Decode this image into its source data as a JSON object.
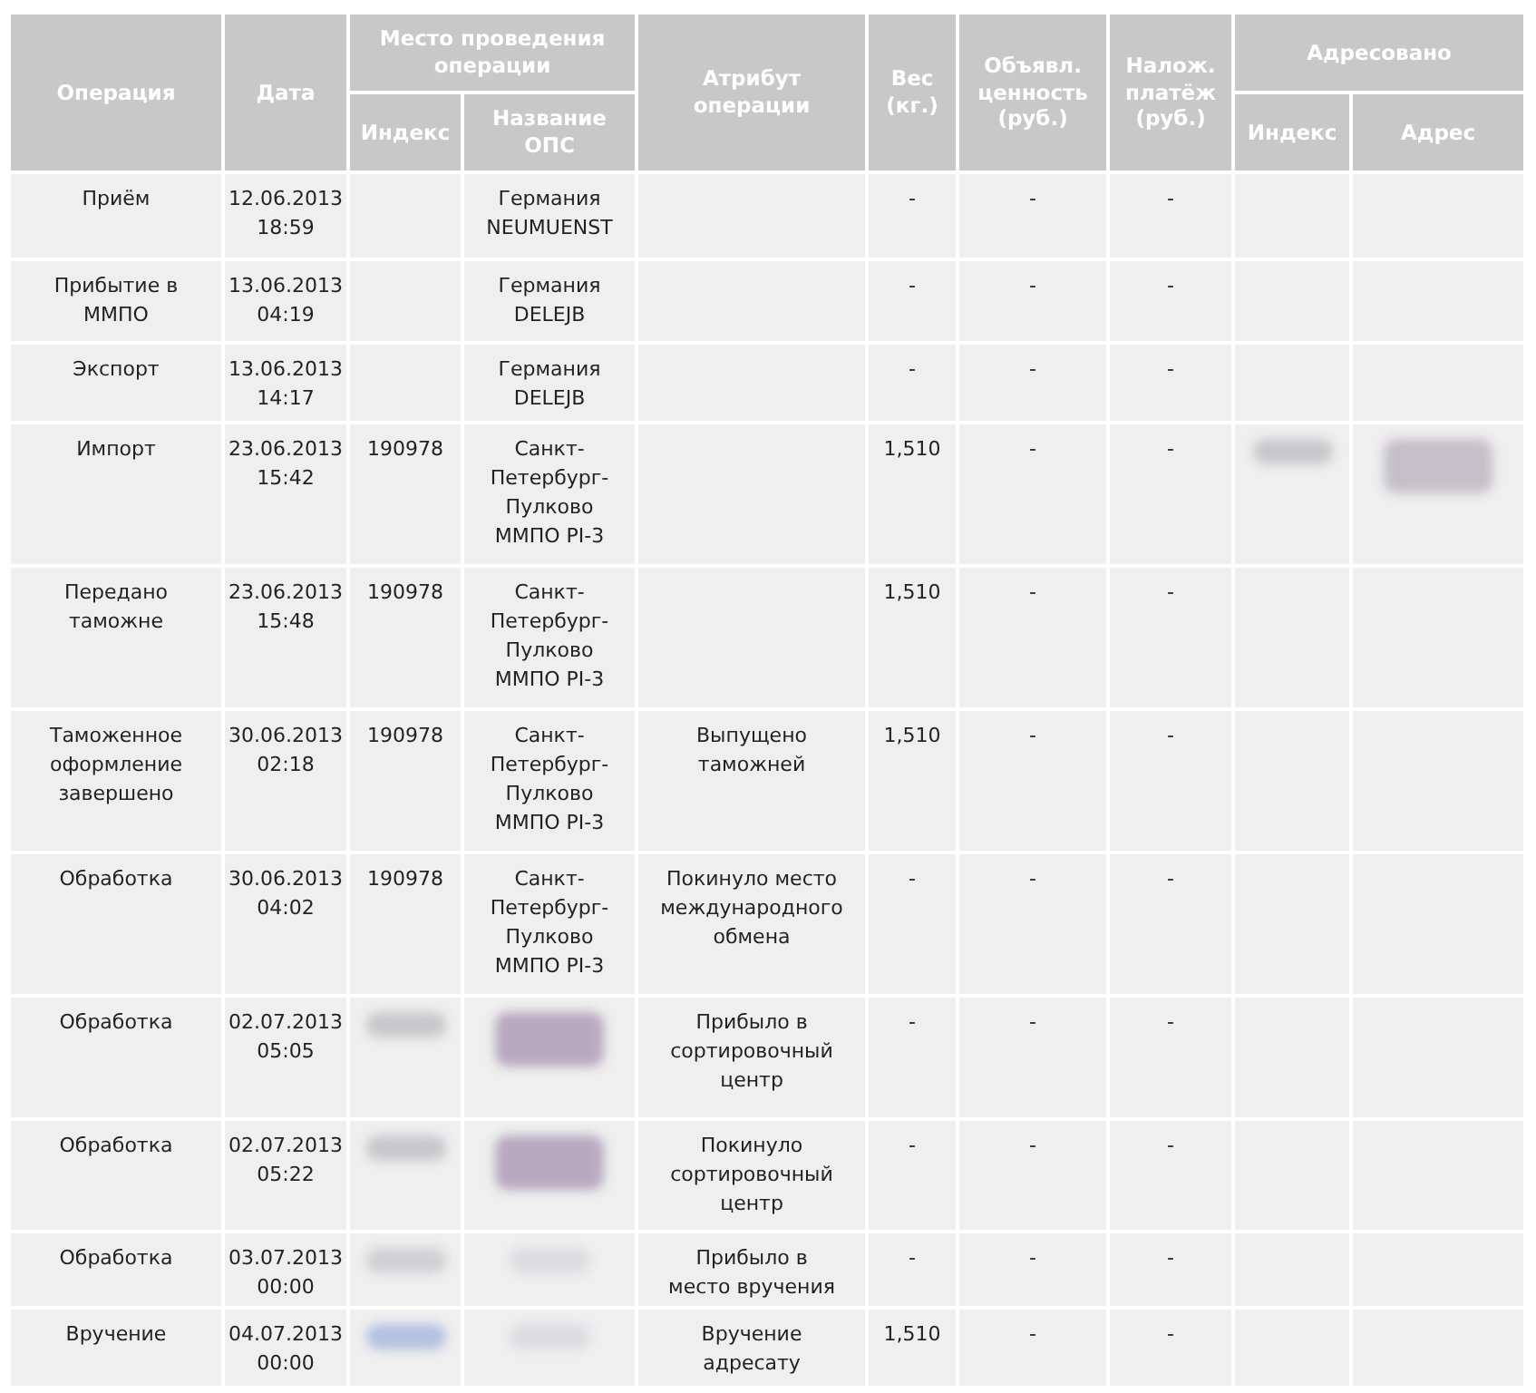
{
  "table": {
    "header_rows": [
      [
        {
          "text": "Операция",
          "rowspan": 2
        },
        {
          "text": "Дата",
          "rowspan": 2
        },
        {
          "text": "Место проведения\nоперации",
          "colspan": 2
        },
        {
          "text": "Атрибут\nоперации",
          "rowspan": 2
        },
        {
          "text": "Вес\n(кг.)",
          "rowspan": 2
        },
        {
          "text": "Объявл.\nценность\n(руб.)",
          "rowspan": 2
        },
        {
          "text": "Налож.\nплатёж\n(руб.)",
          "rowspan": 2
        },
        {
          "text": "Адресовано",
          "colspan": 2
        }
      ],
      [
        {
          "text": "Индекс"
        },
        {
          "text": "Название\nОПС"
        },
        {
          "text": "Индекс"
        },
        {
          "text": "Адрес"
        }
      ]
    ],
    "rows": [
      [
        {
          "kind": "text",
          "text": "Приём"
        },
        {
          "kind": "text",
          "text": "12.06.2013\n18:59"
        },
        null,
        {
          "kind": "text",
          "text": "Германия\nNEUMUENST"
        },
        null,
        {
          "kind": "text",
          "text": "-"
        },
        {
          "kind": "text",
          "text": "-"
        },
        {
          "kind": "text",
          "text": "-"
        },
        null,
        null
      ],
      [
        {
          "kind": "text",
          "text": "Прибытие в\nММПО"
        },
        {
          "kind": "text",
          "text": "13.06.2013\n04:19"
        },
        null,
        {
          "kind": "text",
          "text": "Германия\nDELEJB"
        },
        null,
        {
          "kind": "text",
          "text": "-"
        },
        {
          "kind": "text",
          "text": "-"
        },
        {
          "kind": "text",
          "text": "-"
        },
        null,
        null
      ],
      [
        {
          "kind": "text",
          "text": "Экспорт"
        },
        {
          "kind": "text",
          "text": "13.06.2013\n14:17"
        },
        null,
        {
          "kind": "text",
          "text": "Германия\nDELEJB"
        },
        null,
        {
          "kind": "text",
          "text": "-"
        },
        {
          "kind": "text",
          "text": "-"
        },
        {
          "kind": "text",
          "text": "-"
        },
        null,
        null
      ],
      [
        {
          "kind": "text",
          "text": "Импорт"
        },
        {
          "kind": "text",
          "text": "23.06.2013\n15:42"
        },
        {
          "kind": "text",
          "text": "190978"
        },
        {
          "kind": "text",
          "text": "Санкт-\nПетербург-\nПулково\nММПО PI-3"
        },
        null,
        {
          "kind": "text",
          "text": "1,510"
        },
        {
          "kind": "text",
          "text": "-"
        },
        {
          "kind": "text",
          "text": "-"
        },
        {
          "kind": "blurred",
          "color": "#c8c8cc"
        },
        {
          "kind": "blurred",
          "color": "#c4c0c8"
        }
      ],
      [
        {
          "kind": "text",
          "text": "Передано\nтаможне"
        },
        {
          "kind": "text",
          "text": "23.06.2013\n15:48"
        },
        {
          "kind": "text",
          "text": "190978"
        },
        {
          "kind": "text",
          "text": "Санкт-\nПетербург-\nПулково\nММПО PI-3"
        },
        null,
        {
          "kind": "text",
          "text": "1,510"
        },
        {
          "kind": "text",
          "text": "-"
        },
        {
          "kind": "text",
          "text": "-"
        },
        null,
        null
      ],
      [
        {
          "kind": "text",
          "text": "Таможенное\nоформление\nзавершено"
        },
        {
          "kind": "text",
          "text": "30.06.2013\n02:18"
        },
        {
          "kind": "text",
          "text": "190978"
        },
        {
          "kind": "text",
          "text": "Санкт-\nПетербург-\nПулково\nММПО PI-3"
        },
        {
          "kind": "text",
          "text": "Выпущено\nтаможней"
        },
        {
          "kind": "text",
          "text": "1,510"
        },
        {
          "kind": "text",
          "text": "-"
        },
        {
          "kind": "text",
          "text": "-"
        },
        null,
        null
      ],
      [
        {
          "kind": "text",
          "text": "Обработка"
        },
        {
          "kind": "text",
          "text": "30.06.2013\n04:02"
        },
        {
          "kind": "text",
          "text": "190978"
        },
        {
          "kind": "text",
          "text": "Санкт-\nПетербург-\nПулково\nММПО PI-3"
        },
        {
          "kind": "text",
          "text": "Покинуло место\nмеждународного\nобмена"
        },
        {
          "kind": "text",
          "text": "-"
        },
        {
          "kind": "text",
          "text": "-"
        },
        {
          "kind": "text",
          "text": "-"
        },
        null,
        null
      ],
      [
        {
          "kind": "text",
          "text": "Обработка"
        },
        {
          "kind": "text",
          "text": "02.07.2013\n05:05"
        },
        {
          "kind": "blurred",
          "color": "#c8c8cc"
        },
        {
          "kind": "blurred",
          "color": "#b8a8c0"
        },
        {
          "kind": "text",
          "text": "Прибыло в\nсортировочный\nцентр"
        },
        {
          "kind": "text",
          "text": "-"
        },
        {
          "kind": "text",
          "text": "-"
        },
        {
          "kind": "text",
          "text": "-"
        },
        null,
        null
      ],
      [
        {
          "kind": "text",
          "text": "Обработка"
        },
        {
          "kind": "text",
          "text": "02.07.2013\n05:22"
        },
        {
          "kind": "blurred",
          "color": "#c8c8cc"
        },
        {
          "kind": "blurred",
          "color": "#b8a8c0"
        },
        {
          "kind": "text",
          "text": "Покинуло\nсортировочный\nцентр"
        },
        {
          "kind": "text",
          "text": "-"
        },
        {
          "kind": "text",
          "text": "-"
        },
        {
          "kind": "text",
          "text": "-"
        },
        null,
        null
      ],
      [
        {
          "kind": "text",
          "text": "Обработка"
        },
        {
          "kind": "text",
          "text": "03.07.2013\n00:00"
        },
        {
          "kind": "blurred",
          "color": "#d0d0d4"
        },
        {
          "kind": "blurred",
          "color": "#dcdce0"
        },
        {
          "kind": "text",
          "text": "Прибыло в\nместо вручения"
        },
        {
          "kind": "text",
          "text": "-"
        },
        {
          "kind": "text",
          "text": "-"
        },
        {
          "kind": "text",
          "text": "-"
        },
        null,
        null
      ],
      [
        {
          "kind": "text",
          "text": "Вручение"
        },
        {
          "kind": "text",
          "text": "04.07.2013\n00:00"
        },
        {
          "kind": "blurred",
          "color": "#b4c0e0"
        },
        {
          "kind": "blurred",
          "color": "#dcdce0"
        },
        {
          "kind": "text",
          "text": "Вручение\nадресату"
        },
        {
          "kind": "text",
          "text": "1,510"
        },
        {
          "kind": "text",
          "text": "-"
        },
        {
          "kind": "text",
          "text": "-"
        },
        null,
        null
      ]
    ]
  }
}
